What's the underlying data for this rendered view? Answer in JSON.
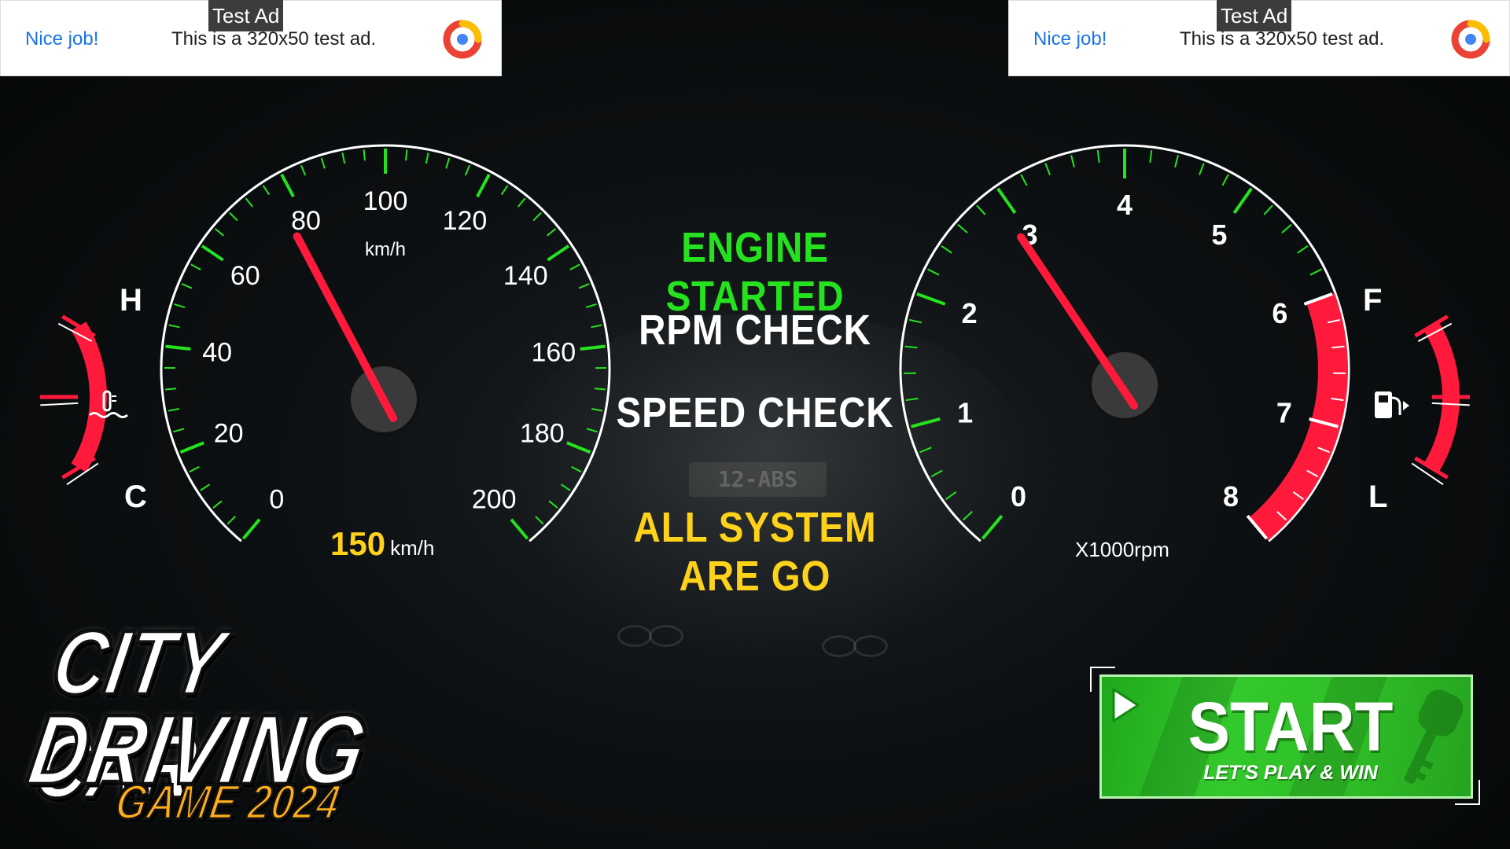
{
  "ads": [
    {
      "nice": "Nice job!",
      "text": "This is a 320x50 test ad.",
      "tag": "Test Ad"
    },
    {
      "nice": "Nice job!",
      "text": "This is a 320x50 test ad.",
      "tag": "Test Ad"
    }
  ],
  "background": {
    "plate": "12-ABS"
  },
  "status": {
    "engine": "ENGINE STARTED",
    "rpm": "RPM CHECK",
    "speed": "SPEED CHECK",
    "all_go": "ALL SYSTEM ARE GO"
  },
  "speedometer": {
    "unit_label": "km/h",
    "ticks": [
      "0",
      "20",
      "40",
      "60",
      "80",
      "100",
      "120",
      "140",
      "160",
      "180",
      "200"
    ],
    "needle_value": 80,
    "readout_value": "150",
    "readout_unit": "km/h"
  },
  "tachometer": {
    "ticks": [
      "0",
      "1",
      "2",
      "3",
      "4",
      "5",
      "6",
      "7",
      "8"
    ],
    "needle_value": 3,
    "redline_from": 6,
    "unit_label": "X1000rpm"
  },
  "temp_gauge": {
    "high": "H",
    "low": "C",
    "icon": "coolant-temperature-icon"
  },
  "fuel_gauge": {
    "full": "F",
    "low": "L",
    "icon": "fuel-pump-icon"
  },
  "logo": {
    "line1": "CITY CAR",
    "line2": "DRIVING",
    "line3": "GAME 2024"
  },
  "start_button": {
    "label": "START",
    "sub": "LET'S PLAY & WIN",
    "icon": "play-icon"
  },
  "colors": {
    "green": "#25e21f",
    "red": "#ff1a3c",
    "yellow": "#ffd21a",
    "start_green": "#2fbf27"
  }
}
